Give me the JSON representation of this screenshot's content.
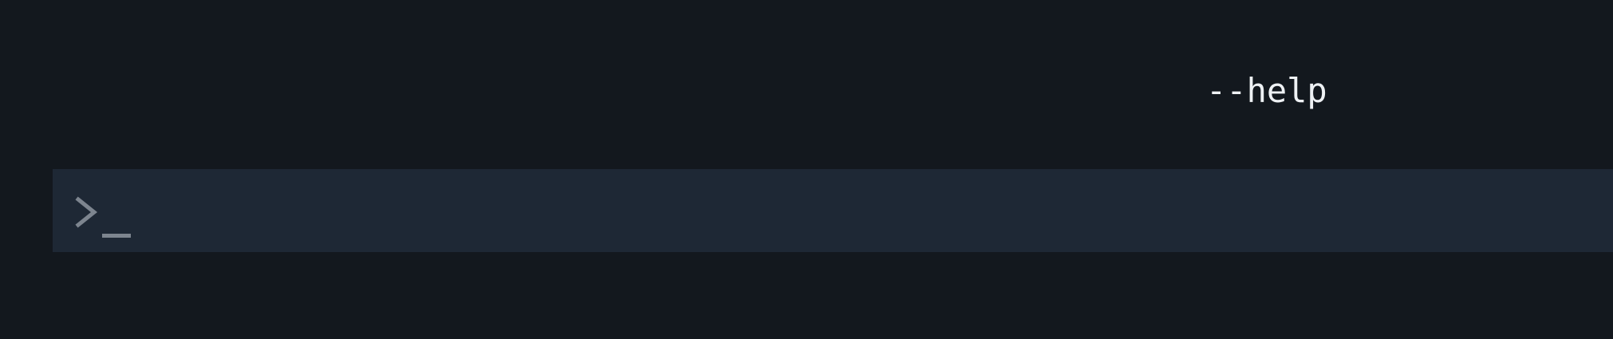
{
  "terminal": {
    "output_text": "--help",
    "prompt_icon": "terminal-prompt-icon",
    "colors": {
      "background": "#13181e",
      "input_bar": "#1e2835",
      "text": "#eef1f4",
      "prompt": "#7d858f"
    }
  }
}
